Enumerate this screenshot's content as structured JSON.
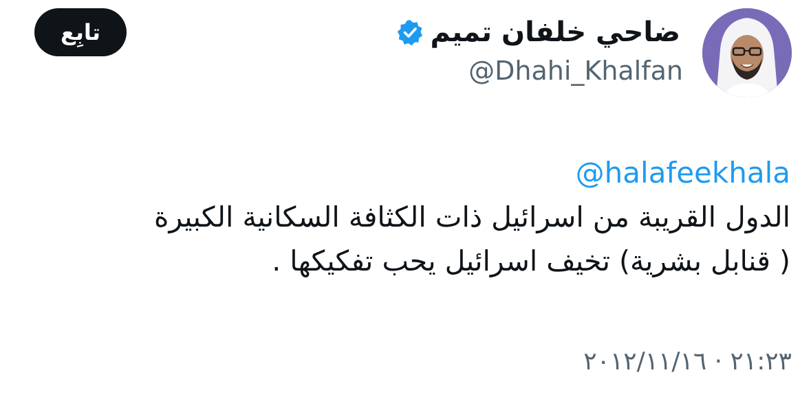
{
  "author": {
    "display_name": "ضاحي خلفان تميم",
    "handle": "@Dhahi_Khalfan",
    "verified_icon": "verified-badge-icon",
    "avatar": "profile-photo"
  },
  "follow_button": {
    "label": "تابِع"
  },
  "tweet": {
    "mention": "@halafeekhala",
    "lines": [
      "الدول القريبة من اسرائيل ذات الكثافة السكانية الكبيرة",
      "( قنابل بشرية) تخيف اسرائيل يحب تفكيكها ."
    ],
    "timestamp": "٢١:٢٣ · ٢٠١٢/١١/١٦"
  },
  "colors": {
    "text": "#0f1419",
    "secondary": "#536471",
    "accent": "#1d9bf0",
    "button_bg": "#0f1419",
    "button_text": "#ffffff"
  }
}
